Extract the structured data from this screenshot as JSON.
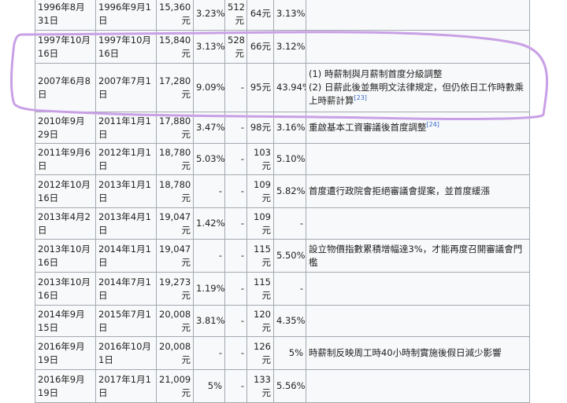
{
  "rows": [
    {
      "announced": "1996年8月31日",
      "effective": "1996年9月1日",
      "monthly": "15,360元",
      "monthly_pct": "3.23%",
      "hourly": "512元",
      "daily": "64元",
      "daily_pct": "3.13%",
      "note": [],
      "ref": ""
    },
    {
      "announced": "1997年10月16日",
      "effective": "1997年10月16日",
      "monthly": "15,840元",
      "monthly_pct": "3.13%",
      "hourly": "528元",
      "daily": "66元",
      "daily_pct": "3.12%",
      "note": [],
      "ref": ""
    },
    {
      "announced": "2007年6月8日",
      "effective": "2007年7月1日",
      "monthly": "17,280元",
      "monthly_pct": "9.09%",
      "hourly": "-",
      "daily": "95元",
      "daily_pct": "43.94%",
      "note": [
        "(1) 時薪制與月薪制首度分級調整",
        "(2) 日薪此後並無明文法律規定，但仍依日工作時數乘上時薪計算"
      ],
      "ref": "[23]"
    },
    {
      "announced": "2010年9月29日",
      "effective": "2011年1月1日",
      "monthly": "17,880元",
      "monthly_pct": "3.47%",
      "hourly": "-",
      "daily": "98元",
      "daily_pct": "3.16%",
      "note": [
        "重啟基本工資審議後首度調整"
      ],
      "ref": "[24]"
    },
    {
      "announced": "2011年9月6日",
      "effective": "2012年1月1日",
      "monthly": "18,780元",
      "monthly_pct": "5.03%",
      "hourly": "-",
      "daily": "103元",
      "daily_pct": "5.10%",
      "note": [],
      "ref": ""
    },
    {
      "announced": "2012年10月16日",
      "effective": "2013年1月1日",
      "monthly": "18,780元",
      "monthly_pct": "-",
      "hourly": "-",
      "daily": "109元",
      "daily_pct": "5.82%",
      "note": [
        "首度遭行政院會拒絕審議會提案，並首度緩漲"
      ],
      "ref": ""
    },
    {
      "announced": "2013年4月2日",
      "effective": "2013年4月1日",
      "monthly": "19,047元",
      "monthly_pct": "1.42%",
      "hourly": "-",
      "daily": "109元",
      "daily_pct": "-",
      "note": [],
      "ref": ""
    },
    {
      "announced": "2013年10月16日",
      "effective": "2014年1月1日",
      "monthly": "19,047元",
      "monthly_pct": "-",
      "hourly": "-",
      "daily": "115元",
      "daily_pct": "5.50%",
      "note": [
        "設立物價指數累積增幅達3%，才能再度召開審議會門檻"
      ],
      "ref": ""
    },
    {
      "announced": "2013年10月16日",
      "effective": "2014年7月1日",
      "monthly": "19,273元",
      "monthly_pct": "1.19%",
      "hourly": "-",
      "daily": "115元",
      "daily_pct": "-",
      "note": [],
      "ref": ""
    },
    {
      "announced": "2014年9月15日",
      "effective": "2015年7月1日",
      "monthly": "20,008元",
      "monthly_pct": "3.81%",
      "hourly": "-",
      "daily": "120元",
      "daily_pct": "4.35%",
      "note": [],
      "ref": ""
    },
    {
      "announced": "2016年9月19日",
      "effective": "2016年10月1日",
      "monthly": "20,008元",
      "monthly_pct": "-",
      "hourly": "-",
      "daily": "126元",
      "daily_pct": "5%",
      "note": [
        "時薪制反映周工時40小時制實施後假日減少影響"
      ],
      "ref": ""
    },
    {
      "announced": "2016年9月19日",
      "effective": "2017年1月1日",
      "monthly": "21,009元",
      "monthly_pct": "5%",
      "hourly": "-",
      "daily": "133元",
      "daily_pct": "5.56%",
      "note": [],
      "ref": ""
    }
  ],
  "colors": {
    "annotation": "#c9a0e6",
    "border": "#a2a9b1",
    "cell_bg": "#f8f9fa",
    "ref_link": "#3366cc"
  }
}
